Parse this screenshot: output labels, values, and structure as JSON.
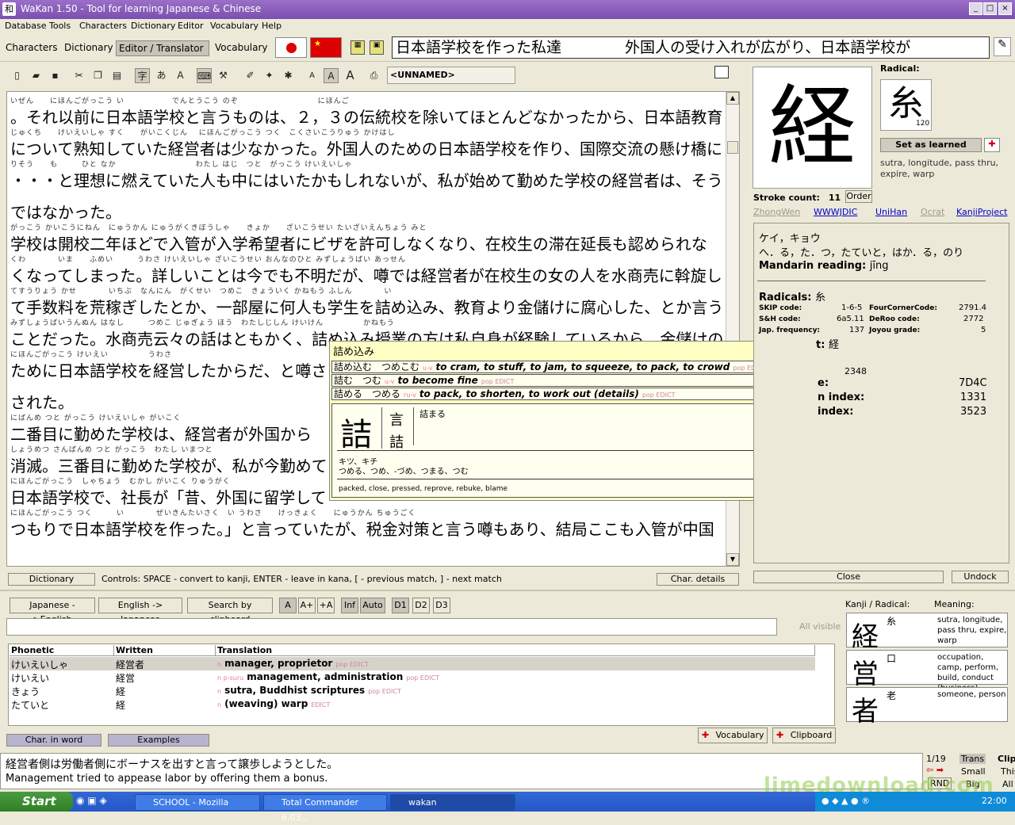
{
  "window": {
    "title": "WaKan 1.50 - Tool for learning Japanese & Chinese",
    "app_icon": "和"
  },
  "menu": [
    "Database",
    "Tools",
    "Characters",
    "Dictionary",
    "Editor",
    "Vocabulary",
    "Help"
  ],
  "modes": [
    "Characters",
    "Dictionary",
    "Editor / Translator",
    "Vocabulary"
  ],
  "active_mode": "Editor / Translator",
  "sentence_bar": {
    "left": "日本語学校を作った私達",
    "right": "外国人の受け入れが広がり、日本語学校が"
  },
  "document": {
    "name": "<UNNAMED>"
  },
  "editor_lines": [
    {
      "ruby": "いぜん　　にほんごがっこう い　　　　　　でんとうこう のぞ　　　　　　　　　　にほんご",
      "text": "。それ以前に日本語学校と言うものは、２，３の伝統校を除いてほとんどなかったから、日本語教育"
    },
    {
      "ruby": "じゅくち　　けいえいしゃ すく　　がいこくじん　 にほんごがっこう つく　こくさいこうりゅう かけはし",
      "text": "について熟知していた経営者は少なかった。外国人のための日本語学校を作り、国際交流の懸け橋に"
    },
    {
      "ruby": "りそう　　も　　　ひと なか　　　　　　　　　　わたし はじ　つと　がっこう けいえいしゃ",
      "text": "・・・と理想に燃えていた人も中にはいたかもしれないが、私が始めて勤めた学校の経営者は、そう"
    },
    {
      "ruby": "",
      "text": "ではなかった。"
    },
    {
      "ruby": "がっこう かいこうにねん　にゅうかん にゅうがくきぼうしゃ　　きょか　　ざいこうせい たいざいえんちょう みと",
      "text": "学校は開校二年ほどで入管が入学希望者にビザを許可しなくなり、在校生の滞在延長も認められな"
    },
    {
      "ruby": "くわ　　　　いま　　ふめい　　　うわさ けいえいしゃ ざいこうせい おんなのひと みずしょうばい あっせん",
      "text": "くなってしまった。詳しいことは今でも不明だが、噂では経営者が在校生の女の人を水商売に斡旋し"
    },
    {
      "ruby": "てすうりょう かせ　　　　いちぶ　なんにん　がくせい　つめこ　きょういく かねもう ふしん　　　　い",
      "text": "て手数料を荒稼ぎしたとか、一部屋に何人も学生を詰め込み、教育より金儲けに腐心した、とか言う"
    },
    {
      "ruby": "みずしょうばいうんぬん はなし　　　つめこ じゅぎょう ほう　わたしじしん けいけん　　　　　かねもう",
      "text": "ことだった。水商売云々の話はともかく、詰め込み授業の方は私自身が経験しているから、金儲けの"
    },
    {
      "ruby": "にほんごがっこう けいえい　　　　　うわさ",
      "text": "ために日本語学校を経営したからだ、と噂さ"
    },
    {
      "ruby": "",
      "text": "された。"
    },
    {
      "ruby": "にばんめ つと がっこう けいえいしゃ がいこく",
      "text": "二番目に勤めた学校は、経営者が外国から"
    },
    {
      "ruby": "しょうめつ さんばんめ つと がっこう　わたし いまつと",
      "text": "消滅。三番目に勤めた学校が、私が今勤めて"
    },
    {
      "ruby": "にほんごがっこう　しゃちょう　むかし がいこく りゅうがく",
      "text": "日本語学校で、社長が「昔、外国に留学して"
    },
    {
      "ruby": "にほんごがっこう つく　　　い　　　　ぜいきんたいさく　い うわさ　　けっきょく　　にゅうかん ちゅうごく",
      "text": "つもりで日本語学校を作った。」と言っていたが、税金対策と言う噂もあり、結局ここも入管が中国"
    }
  ],
  "popup": {
    "header": "詰め込み",
    "entries": [
      {
        "kanji": "詰め込む",
        "kana": "つめこむ",
        "pos": "u-v",
        "meaning": "to cram, to stuff, to jam, to squeeze, to pack, to crowd",
        "tags": "pop EDICT"
      },
      {
        "kanji": "詰む",
        "kana": "つむ",
        "pos": "u-v",
        "meaning": "to become fine",
        "tags": "pop EDICT"
      },
      {
        "kanji": "詰める",
        "kana": "つめる",
        "pos": "ru-v",
        "meaning": "to pack, to shorten, to work out (details)",
        "tags": "pop EDICT"
      }
    ],
    "kanji": "詰",
    "radicals": [
      "言",
      "詰"
    ],
    "compound": "詰まる",
    "on_reading": "キツ、キチ",
    "kun_reading": "つめる、つめ、-づめ、つまる、つむ",
    "meaning": "packed, close, pressed, reprove, rebuke, blame"
  },
  "editor_buttons": {
    "dictionary": "Dictionary",
    "controls": "Controls: SPACE - convert to kanji, ENTER - leave in kana, [ - previous match, ] - next match",
    "char_details": "Char. details"
  },
  "kanji_detail": {
    "kanji": "経",
    "radical_label": "Radical:",
    "radical": "糸",
    "radical_number": "120",
    "set_learned": "Set as learned",
    "meanings": "sutra, longitude, pass thru, expire, warp",
    "stroke_label": "Stroke count:",
    "stroke_count": "11",
    "order_label": "Order",
    "links": [
      {
        "label": "ZhongWen",
        "on": false
      },
      {
        "label": "WWWJDIC",
        "on": true
      },
      {
        "label": "UniHan",
        "on": true
      },
      {
        "label": "Ocrat",
        "on": false
      },
      {
        "label": "KanjiProject",
        "on": true
      }
    ],
    "readings_on": "ケイ，キョウ",
    "readings_kun": "へ．る，た．つ，たていと，はか．る，のり",
    "mandarin_label": "Mandarin reading:",
    "mandarin": "jīng",
    "radicals_label": "Radicals:",
    "radicals_value": "糸",
    "skip_label": "SKIP code:",
    "skip": "1-6-5",
    "fourcorner_label": "FourCornerCode:",
    "fourcorner": "2791.4",
    "sh_label": "S&H code:",
    "sh": "6a5.11",
    "deroo_label": "DeRoo code:",
    "deroo": "2772",
    "freq_label": "Jap. frequency:",
    "freq": "137",
    "joyou_label": "Joyou grade:",
    "joyou": "5",
    "variant_label": "t:",
    "variant": "経",
    "row1_value": "2348",
    "row2_label": "e:",
    "row2_value": "7D4C",
    "row3_label": "n index:",
    "row3_value": "1331",
    "row4_label": "index:",
    "row4_value": "3523",
    "close": "Close",
    "undock": "Undock"
  },
  "dict_buttons": [
    "Japanese ->English",
    "English -> Japanese",
    "Search by clipboard"
  ],
  "dict_toggles": [
    "A",
    "A+",
    "+A",
    "Inf",
    "Auto",
    "D1",
    "D2",
    "D3"
  ],
  "all_visible": "All visible",
  "table": {
    "headers": [
      "Phonetic",
      "Written",
      "Translation"
    ],
    "rows": [
      {
        "phonetic": "けいえいしゃ",
        "written": "経営者",
        "pos": "n",
        "translation": "manager, proprietor",
        "tags": "pop EDICT",
        "selected": true
      },
      {
        "phonetic": "けいえい",
        "written": "経営",
        "pos": "n p-suru",
        "translation": "management, administration",
        "tags": "pop EDICT",
        "selected": false
      },
      {
        "phonetic": "きょう",
        "written": "経",
        "pos": "n",
        "translation": "sutra, Buddhist scriptures",
        "tags": "pop EDICT",
        "selected": false
      },
      {
        "phonetic": "たていと",
        "written": "経",
        "pos": "n",
        "translation": "(weaving) warp",
        "tags": "EDICT",
        "selected": false
      }
    ]
  },
  "bottom_buttons": {
    "char_in_word": "Char. in word",
    "examples": "Examples",
    "vocabulary": "Vocabulary",
    "clipboard": "Clipboard"
  },
  "kanji_list": {
    "header_kanji": "Kanji / Radical:",
    "header_meaning": "Meaning:",
    "items": [
      {
        "kanji": "経",
        "radical": "糸",
        "meaning": "sutra, longitude, pass thru, expire, warp"
      },
      {
        "kanji": "営",
        "radical": "口",
        "meaning": "occupation, camp, perform, build, conduct (business)"
      },
      {
        "kanji": "者",
        "radical": "老",
        "meaning": "someone, person"
      }
    ]
  },
  "example": {
    "japanese": "経営者側は労働者側にボーナスを出すと言って譲歩しようとした。",
    "english": "Management tried to appease labor by offering them a bonus."
  },
  "example_nav": {
    "count": "1/19",
    "rnd": "RND",
    "trans": "Trans",
    "clip": "Clip",
    "small": "Small",
    "this": "This",
    "big": "Big",
    "all": "All"
  },
  "taskbar": {
    "start": "Start",
    "tasks": [
      "SCHOOL - Mozilla",
      "Total Commander 6.03...",
      "wakan"
    ],
    "time": "22:00"
  },
  "watermark": "limedownload.com"
}
